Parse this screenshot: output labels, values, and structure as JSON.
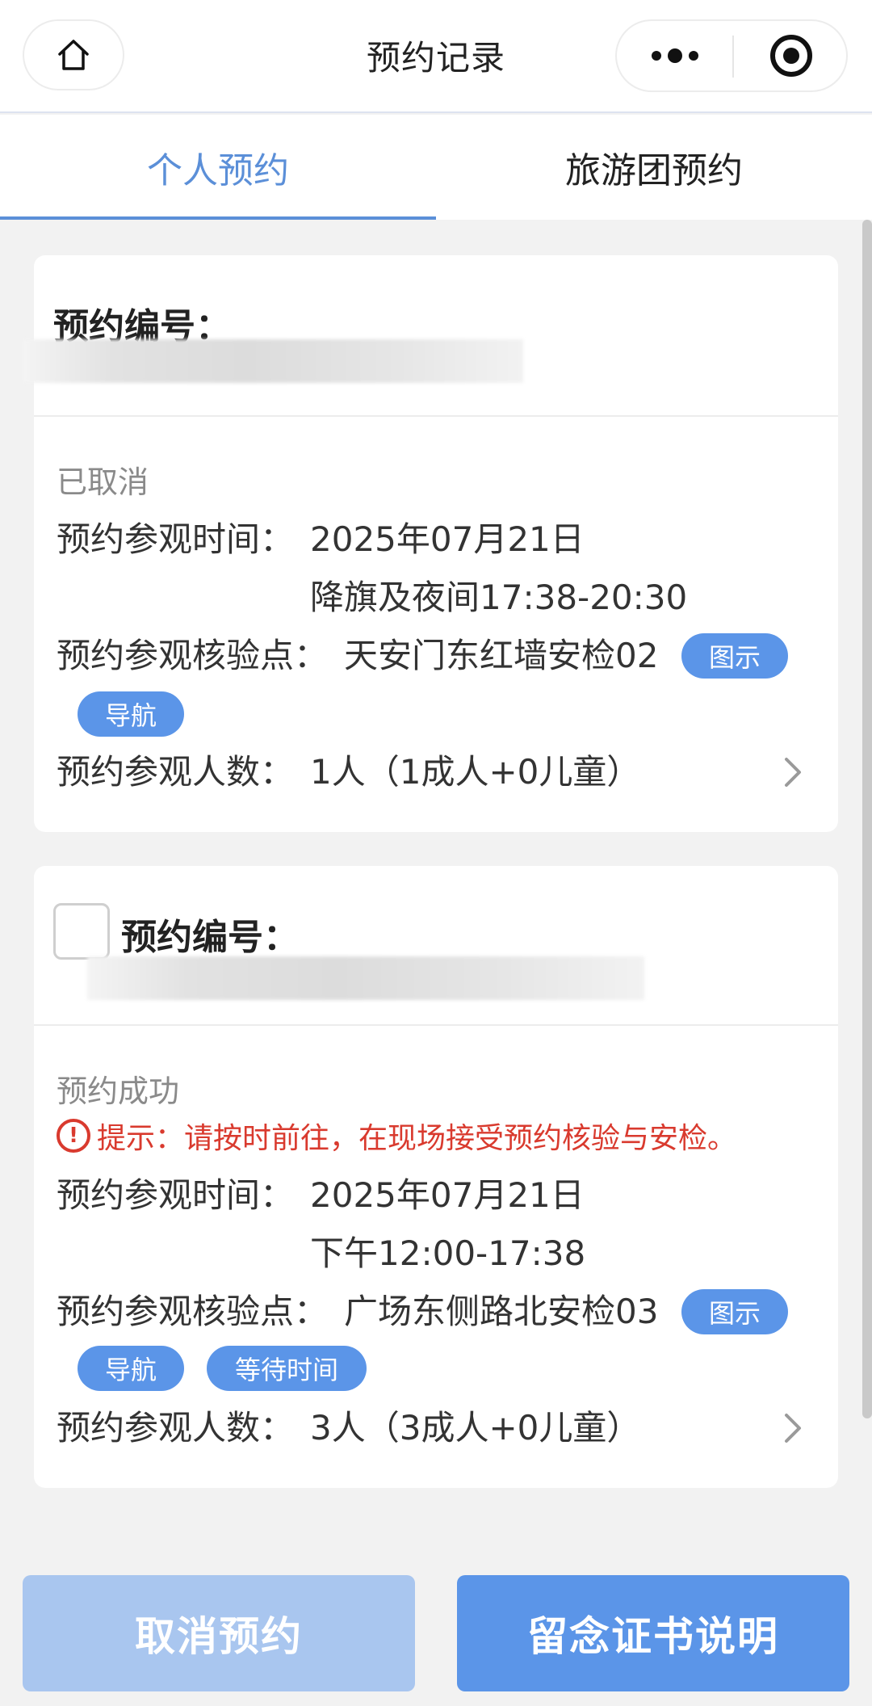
{
  "header": {
    "title": "预约记录",
    "home_icon": "home-icon",
    "more_icon": "more-dots-icon",
    "close_icon": "target-circle-icon"
  },
  "tabs": [
    {
      "label": "个人预约",
      "active": true
    },
    {
      "label": "旅游团预约",
      "active": false
    }
  ],
  "records": [
    {
      "number_label": "预约编号：",
      "status": "已取消",
      "time_label": "预约参观时间：",
      "date": "2025年07月21日",
      "session": "降旗及夜间17:38-20:30",
      "checkpoint_label": "预约参观核验点：",
      "checkpoint": "天安门东红墙安检02",
      "map_button": "图示",
      "nav_button": "导航",
      "visitors_label": "预约参观人数：",
      "visitors": "1人（1成人+0儿童）"
    },
    {
      "number_label": "预约编号：",
      "status": "预约成功",
      "tip": "提示：请按时前往，在现场接受预约核验与安检。",
      "time_label": "预约参观时间：",
      "date": "2025年07月21日",
      "session": "下午12:00-17:38",
      "checkpoint_label": "预约参观核验点：",
      "checkpoint": "广场东侧路北安检03",
      "map_button": "图示",
      "nav_button": "导航",
      "wait_button": "等待时间",
      "visitors_label": "预约参观人数：",
      "visitors": "3人（3成人+0儿童）"
    }
  ],
  "footer": {
    "cancel_button": "取消预约",
    "certificate_button": "留念证书说明"
  },
  "colors": {
    "accent": "#5b95e8",
    "accent_disabled": "#a9c6ef",
    "warning": "#d93a2e",
    "tab_active": "#5b8fd8"
  }
}
